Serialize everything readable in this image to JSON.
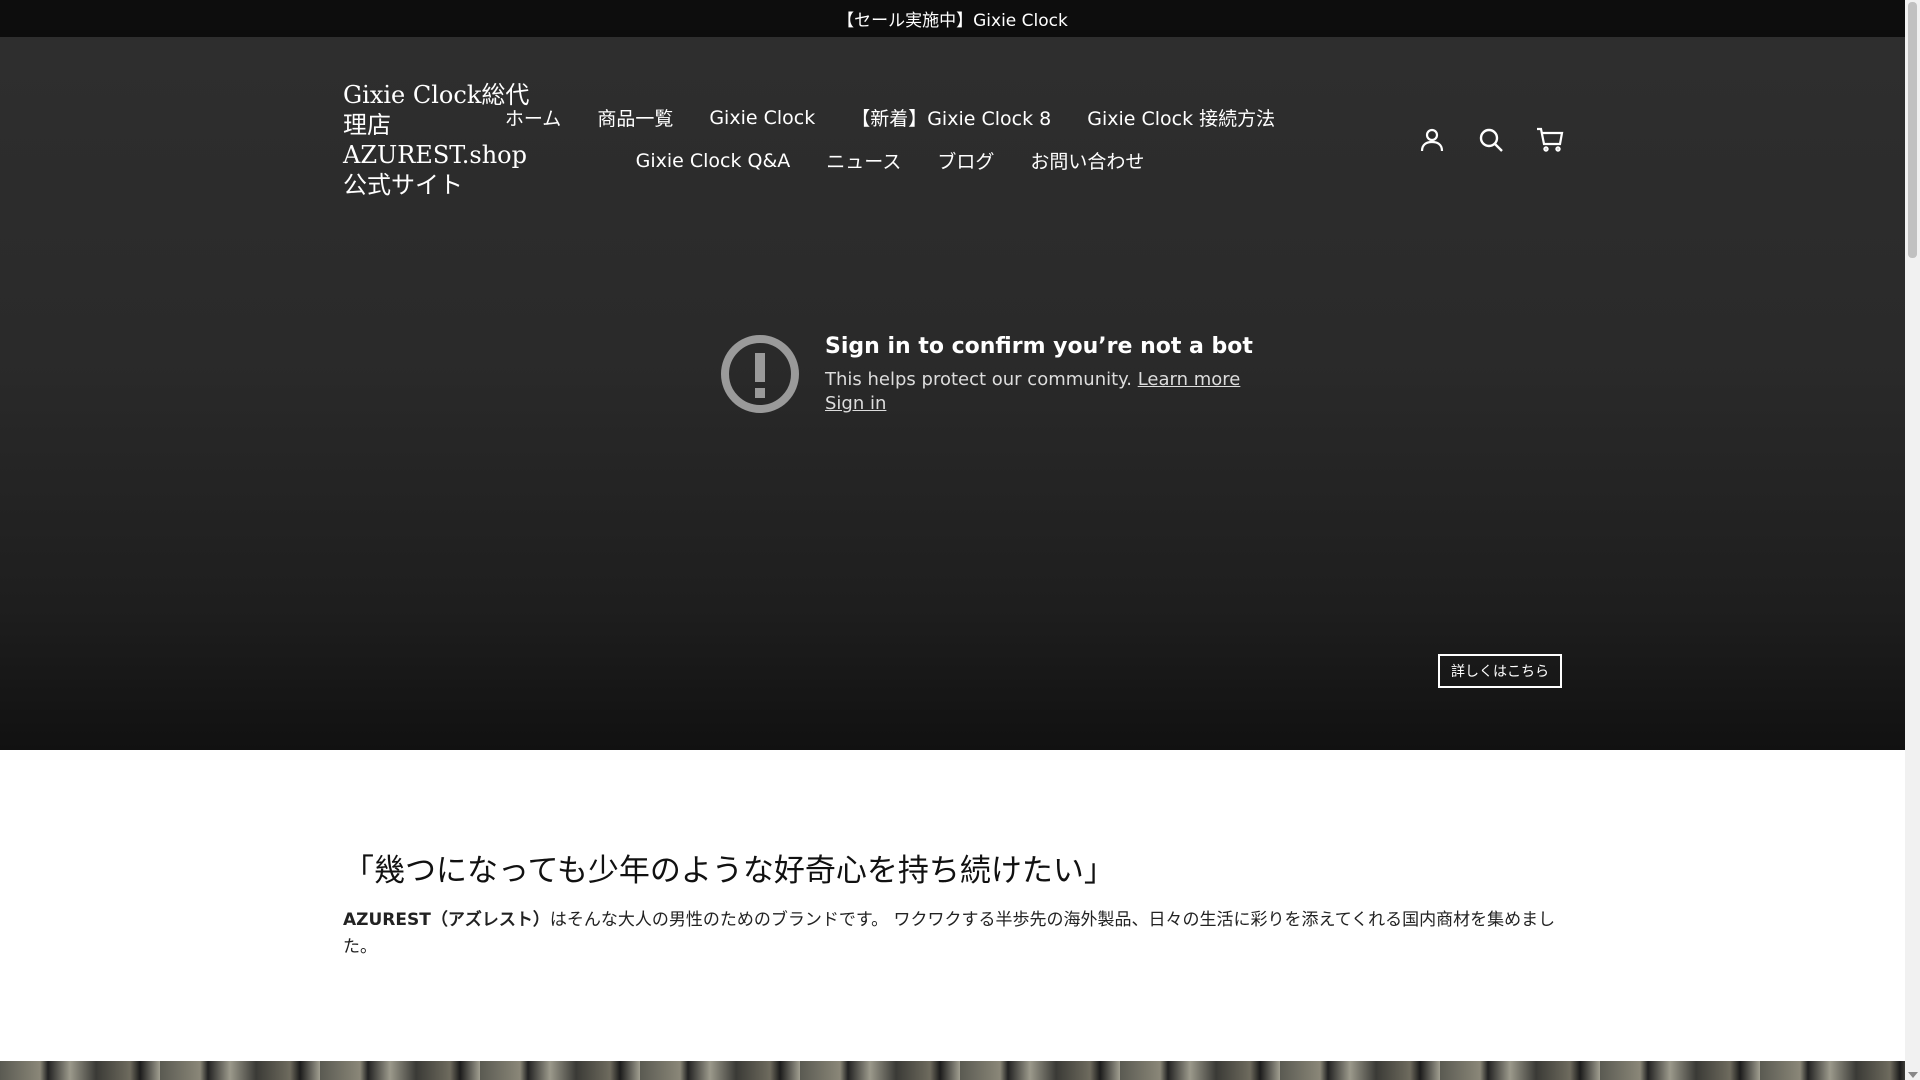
{
  "announcement": {
    "text": "【セール実施中】Gixie Clock"
  },
  "header": {
    "logo": "Gixie Clock総代理店AZUREST.shop公式サイト",
    "nav_row1": [
      "ホーム",
      "商品一覧",
      "Gixie Clock",
      "【新着】Gixie Clock 8",
      "Gixie Clock 接続方法"
    ],
    "nav_row2": [
      "Gixie Clock Q&A",
      "ニュース",
      "ブログ",
      "お問い合わせ"
    ],
    "icons": [
      "account-icon",
      "search-icon",
      "cart-icon"
    ]
  },
  "video_block": {
    "title": "Sign in to confirm you’re not a bot",
    "text": "This helps protect our community.",
    "learn_more": "Learn more",
    "sign_in": "Sign in"
  },
  "hero_button": "詳しくはこちら",
  "content": {
    "headline": "「幾つになっても少年のような好奇心を持ち続けたい」",
    "intro_bold": "AZUREST（アズレスト）",
    "intro_text": "はそんな大人の男性のためのブランドです。 ワクワクする半歩先の海外製品、日々の生活に彩りを添えてくれる国内商材を集めました。"
  },
  "colors": {
    "announcement_bg": "#0d0d0d",
    "hero_bg": "#2a2a2a",
    "text_light": "#ffffff"
  }
}
